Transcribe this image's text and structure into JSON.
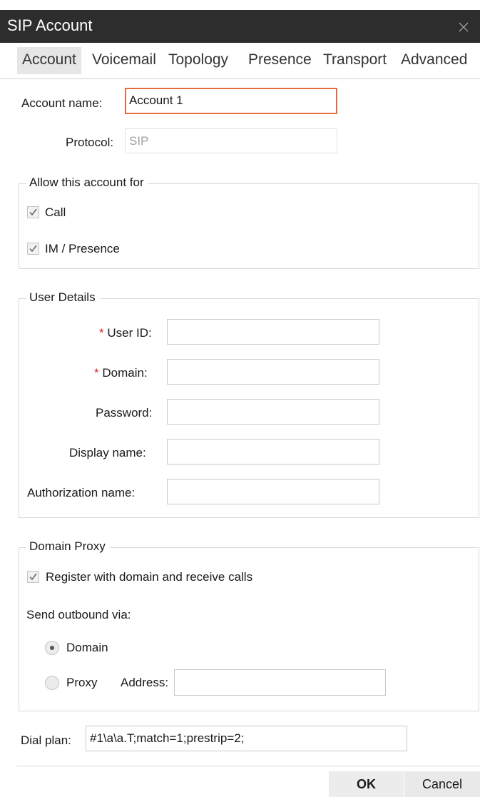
{
  "window": {
    "title": "SIP Account",
    "close_icon": "close-icon"
  },
  "tabs": [
    {
      "label": "Account",
      "active": true
    },
    {
      "label": "Voicemail"
    },
    {
      "label": "Topology"
    },
    {
      "label": "Presence"
    },
    {
      "label": "Transport"
    },
    {
      "label": "Advanced"
    }
  ],
  "account": {
    "name_label": "Account name:",
    "name_value": "Account 1",
    "protocol_label": "Protocol:",
    "protocol_value": "SIP"
  },
  "allow": {
    "legend": "Allow this account for",
    "call_label": "Call",
    "call_checked": true,
    "im_label": "IM / Presence",
    "im_checked": true
  },
  "user_details": {
    "legend": "User Details",
    "required_marker": "*",
    "user_id_label": "User ID:",
    "user_id_value": "",
    "domain_label": "Domain:",
    "domain_value": "",
    "password_label": "Password:",
    "password_value": "",
    "display_name_label": "Display name:",
    "display_name_value": "",
    "auth_name_label": "Authorization name:",
    "auth_name_value": ""
  },
  "domain_proxy": {
    "legend": "Domain Proxy",
    "register_label": "Register with domain and receive calls",
    "register_checked": true,
    "send_via_label": "Send outbound via:",
    "domain_option_label": "Domain",
    "domain_selected": true,
    "proxy_option_label": "Proxy",
    "address_label": "Address:",
    "address_value": ""
  },
  "dial_plan": {
    "label": "Dial plan:",
    "value": "#1\\a\\a.T;match=1;prestrip=2;"
  },
  "buttons": {
    "ok_label": "OK",
    "cancel_label": "Cancel"
  }
}
